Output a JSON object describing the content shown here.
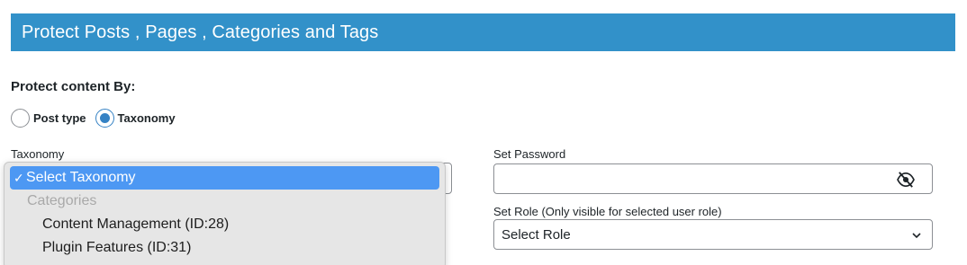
{
  "header": {
    "title": "Protect Posts , Pages , Categories and Tags",
    "bg_color": "#3291c9"
  },
  "protect_by": {
    "label": "Protect content By:",
    "options": [
      {
        "label": "Post type",
        "checked": false
      },
      {
        "label": "Taxonomy",
        "checked": true
      }
    ]
  },
  "taxonomy": {
    "label": "Taxonomy",
    "dropdown": {
      "selected": "Select Taxonomy",
      "group_label": "Categories",
      "items": [
        "Content Management (ID:28)",
        "Plugin Features (ID:31)"
      ]
    }
  },
  "password": {
    "label": "Set Password",
    "value": "",
    "toggle_icon": "eye-slash-icon"
  },
  "role": {
    "label": "Set Role (Only visible for selected user role)",
    "selected": "Select Role"
  },
  "colors": {
    "accent": "#3582c4",
    "dropdown_highlight": "#4d98f3"
  }
}
